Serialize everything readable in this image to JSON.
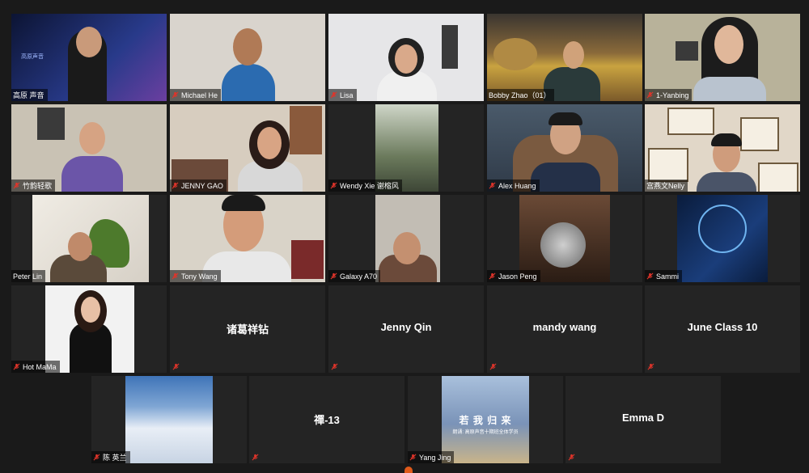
{
  "participants": [
    {
      "name": "高原 声音",
      "bg": "#1b2450",
      "accent": "#3b4fb0",
      "speaking": true,
      "has_video": true
    },
    {
      "name": "Michael He",
      "bg": "#d9d4cd",
      "accent": "#2b6bb0",
      "has_video": true
    },
    {
      "name": "Lisa",
      "bg": "#e6e6e8",
      "accent": "#222222",
      "has_video": true
    },
    {
      "name": "Bobby Zhao（01）",
      "bg": "#7b5a2a",
      "accent": "#c9a340",
      "has_video": true
    },
    {
      "name": "1-Yanbing",
      "bg": "#b8b29a",
      "accent": "#2a2a2a",
      "has_video": true
    },
    {
      "name": "竹韵轻歌",
      "bg": "#c9c2b4",
      "accent": "#6b55a8",
      "has_video": true
    },
    {
      "name": "JENNY GAO",
      "bg": "#d7cdbf",
      "accent": "#8a5a3c",
      "has_video": true
    },
    {
      "name": "Wendy Xie 谢榕风",
      "bg": "#8d9a88",
      "accent": "#3d4636",
      "has_video": true
    },
    {
      "name": "Alex Huang",
      "bg": "#7a5a40",
      "accent": "#243048",
      "has_video": true
    },
    {
      "name": "宫燕文Nelly",
      "bg": "#e1d7c8",
      "accent": "#6e5a3e",
      "has_video": true
    },
    {
      "name": "Peter Lin",
      "bg": "#d6d0c6",
      "accent": "#4d7a2c",
      "has_video": true
    },
    {
      "name": "Tony Wang",
      "bg": "#d9d3c8",
      "accent": "#e8e8e8",
      "has_video": true
    },
    {
      "name": "Galaxy A70",
      "bg": "#c2bdb4",
      "accent": "#6b4a3a",
      "has_video": true
    },
    {
      "name": "Jason Peng",
      "bg": "#4a3426",
      "accent": "#9a8a7a",
      "has_video": true
    },
    {
      "name": "Sammi",
      "bg": "#1a3d7a",
      "accent": "#6fb4f0",
      "has_video": true
    },
    {
      "name": "Hot MaMa",
      "bg": "#f2f2f2",
      "accent": "#111111",
      "has_video": true
    },
    {
      "name": "诸葛祥钻",
      "has_video": false
    },
    {
      "name": "Jenny Qin",
      "has_video": false
    },
    {
      "name": "mandy wang",
      "has_video": false
    },
    {
      "name": "June Class 10",
      "has_video": false
    },
    {
      "name": "陈 英兰",
      "bg": "#7fa6d4",
      "accent": "#ffffff",
      "has_video": true
    },
    {
      "name": "禪-13",
      "has_video": false
    },
    {
      "name": "Yang Jing",
      "bg": "#7a93b8",
      "accent": "#c9b48a",
      "has_video": true,
      "overlay_title": "若 我 归 来",
      "overlay_sub": "朗诵: 高原声音十期班全体学员"
    },
    {
      "name": "Emma D",
      "has_video": false
    }
  ],
  "colors": {
    "background": "#1a1a1a",
    "tile": "#242424",
    "active_speaker": "#c6e03a",
    "muted_mic": "#e0342a"
  }
}
